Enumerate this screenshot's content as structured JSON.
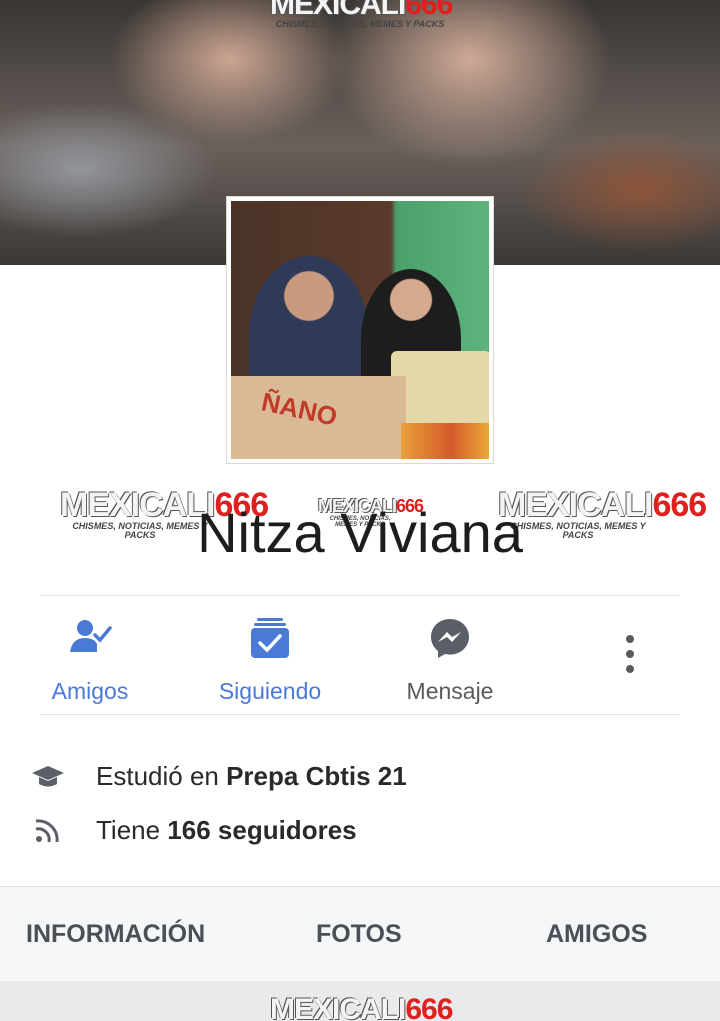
{
  "watermark": {
    "brand_a": "MEXICALI",
    "brand_b": "666",
    "sub": "CHISMES, NOTICIAS, MEMES Y PACKS"
  },
  "profile": {
    "name": "Nitza Viviana",
    "avatar_box_text": "ÑANO"
  },
  "actions": [
    {
      "label": "Amigos",
      "icon": "friends-check-icon"
    },
    {
      "label": "Siguiendo",
      "icon": "following-check-icon"
    },
    {
      "label": "Mensaje",
      "icon": "messenger-icon"
    },
    {
      "label": "",
      "icon": "more-vertical-icon"
    }
  ],
  "info": [
    {
      "prefix": "Estudió en ",
      "bold": "Prepa Cbtis 21",
      "icon": "graduation-cap-icon"
    },
    {
      "prefix": "Tiene ",
      "bold": "166 seguidores",
      "icon": "rss-icon"
    }
  ],
  "tabs": [
    "INFORMACIÓN",
    "FOTOS",
    "AMIGOS"
  ],
  "colors": {
    "accent": "#4a79d6",
    "text": "#1d1d1d",
    "muted": "#5a5a5a",
    "watermark_red": "#e01f1f"
  }
}
